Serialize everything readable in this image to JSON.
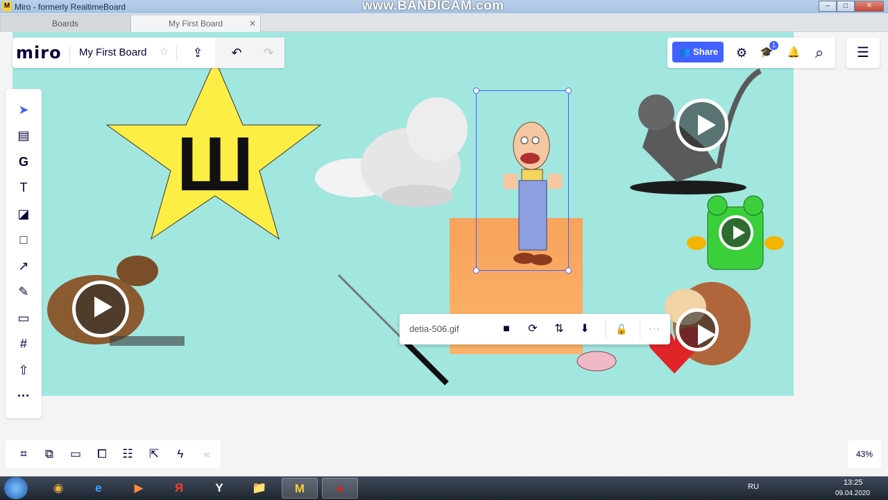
{
  "window": {
    "title": "Miro - formerly RealtimeBoard",
    "watermark": "www.BANDICAM.com",
    "app_icon": "M",
    "controls": {
      "minimize": "–",
      "maximize": "□",
      "close": "✕"
    }
  },
  "tabs": [
    {
      "label": "Boards"
    },
    {
      "label": "My First Board",
      "close": "✕"
    }
  ],
  "topbar": {
    "logo": "miro",
    "board_name": "My First Board",
    "icons": {
      "star": "☆",
      "upload": "⇪",
      "undo": "↶",
      "redo": "↷"
    }
  },
  "rightbar": {
    "share_label": "Share",
    "share_icon": "👥",
    "notification_count": "1",
    "icons": {
      "settings": "⚙",
      "learn": "🎓",
      "bell": "🔔",
      "search": "⌕",
      "notes": "☰"
    }
  },
  "tools": [
    {
      "name": "select-tool",
      "icon": "➤"
    },
    {
      "name": "templates-tool",
      "icon": "▤"
    },
    {
      "name": "google-tool",
      "icon": "G"
    },
    {
      "name": "text-tool",
      "icon": "T"
    },
    {
      "name": "sticky-note-tool",
      "icon": "◪"
    },
    {
      "name": "shape-tool",
      "icon": "□"
    },
    {
      "name": "line-tool",
      "icon": "↗"
    },
    {
      "name": "pen-tool",
      "icon": "✎"
    },
    {
      "name": "comment-tool",
      "icon": "▭"
    },
    {
      "name": "frame-tool",
      "icon": "#"
    },
    {
      "name": "upload-tool",
      "icon": "⇧"
    },
    {
      "name": "more-tools",
      "icon": "···"
    }
  ],
  "bottom_tools": [
    {
      "name": "frames-icon",
      "icon": "⌗"
    },
    {
      "name": "presentation-icon",
      "icon": "⧉"
    },
    {
      "name": "comments-icon",
      "icon": "▭"
    },
    {
      "name": "chat-icon",
      "icon": "⧠"
    },
    {
      "name": "cards-icon",
      "icon": "☷"
    },
    {
      "name": "share-screen-icon",
      "icon": "⇱"
    },
    {
      "name": "activity-icon",
      "icon": "ϟ"
    },
    {
      "name": "collapse-icon",
      "icon": "«"
    }
  ],
  "zoom": "43%",
  "board": {
    "star_letter": "Ш",
    "sticky_color": "#fbac63",
    "board_color": "#a2e6e0"
  },
  "context_toolbar": {
    "file_name": "detia-506.gif",
    "icons": {
      "stop": "■",
      "refresh": "⟳",
      "swap": "⇅",
      "download": "⬇",
      "lock": "🔓",
      "more": "···"
    }
  },
  "taskbar": {
    "apps": [
      {
        "name": "chrome",
        "icon": "◉"
      },
      {
        "name": "ie",
        "icon": "e"
      },
      {
        "name": "media",
        "icon": "▶"
      },
      {
        "name": "yandex",
        "icon": "Я"
      },
      {
        "name": "yandex-browser",
        "icon": "Y"
      },
      {
        "name": "explorer",
        "icon": "📁"
      },
      {
        "name": "miro",
        "icon": "M"
      },
      {
        "name": "bandicam",
        "icon": "●"
      }
    ],
    "lang": "RU",
    "time": "13:25",
    "date": "09.04.2020"
  }
}
